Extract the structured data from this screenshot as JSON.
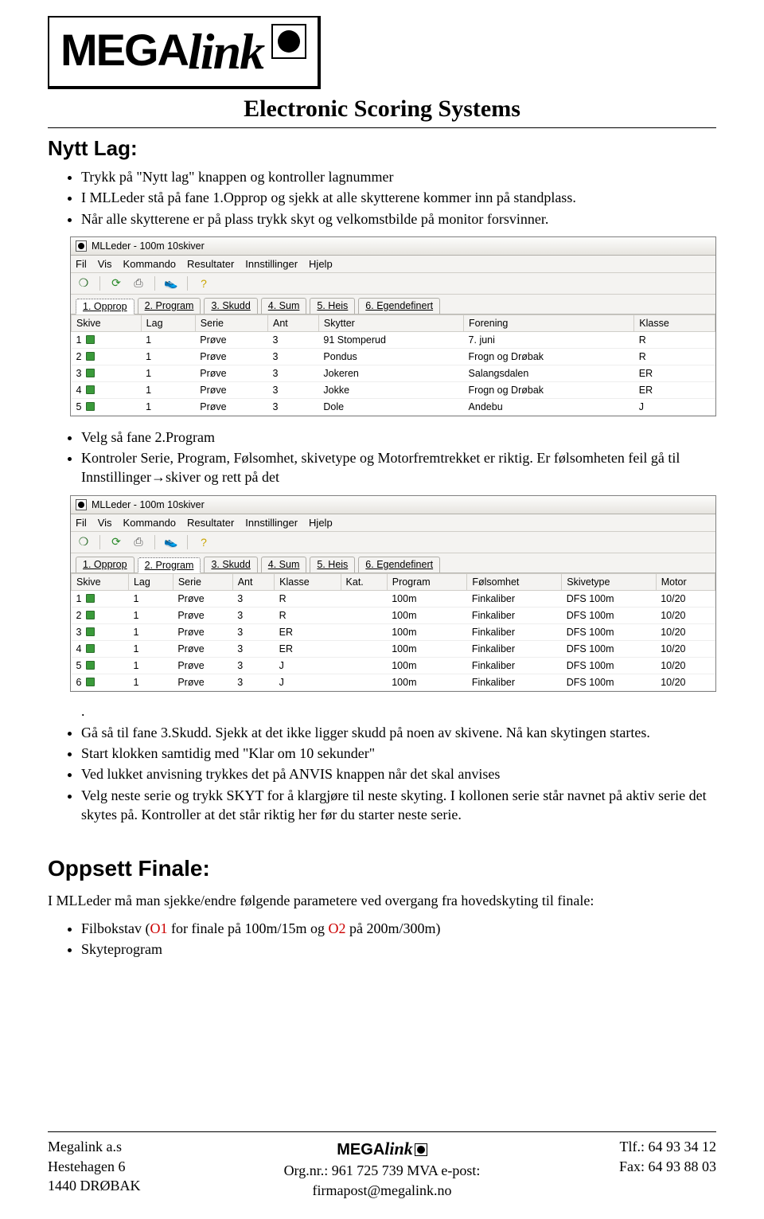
{
  "header": {
    "logo_mega": "MEGA",
    "logo_link": "link",
    "title": "Electronic Scoring Systems"
  },
  "section1": {
    "heading": "Nytt Lag:",
    "bullets_a": [
      "Trykk på \"Nytt lag\" knappen og kontroller lagnummer",
      "I MLLeder stå på fane 1.Opprop og sjekk at alle skytterene kommer inn på standplass.",
      "Når alle skytterene er på plass trykk skyt og velkomstbilde på monitor forsvinner."
    ],
    "bullets_b": [
      "Velg så fane 2.Program",
      "Kontroler Serie, Program, Følsomhet, skivetype og Motorfremtrekket er riktig. Er følsomheten feil gå til Innstillinger→skiver og rett på det"
    ],
    "bullets_c": [
      "Gå så til fane 3.Skudd. Sjekk at det ikke ligger skudd på noen av skivene. Nå kan skytingen startes.",
      "Start klokken samtidig med \"Klar om 10 sekunder\"",
      "Ved lukket anvisning trykkes det på ANVIS knappen når det skal anvises",
      "Velg neste serie og trykk SKYT for å klargjøre til neste skyting. I kollonen serie står navnet på aktiv serie det skytes på. Kontroller at det står riktig her før du starter neste serie."
    ],
    "dot": "."
  },
  "app1": {
    "title": "MLLeder - 100m 10skiver",
    "menus": [
      "Fil",
      "Vis",
      "Kommando",
      "Resultater",
      "Innstillinger",
      "Hjelp"
    ],
    "tabs": [
      "1. Opprop",
      "2. Program",
      "3. Skudd",
      "4. Sum",
      "5. Heis",
      "6. Egendefinert"
    ],
    "active_tab": 0,
    "columns": [
      "Skive",
      "Lag",
      "Serie",
      "Ant",
      "Skytter",
      "Forening",
      "Klasse"
    ],
    "rows": [
      {
        "skive": "1",
        "lag": "1",
        "serie": "Prøve",
        "ant": "3",
        "skytter": "91 Stomperud",
        "forening": "7. juni",
        "klasse": "R"
      },
      {
        "skive": "2",
        "lag": "1",
        "serie": "Prøve",
        "ant": "3",
        "skytter": "Pondus",
        "forening": "Frogn og Drøbak",
        "klasse": "R"
      },
      {
        "skive": "3",
        "lag": "1",
        "serie": "Prøve",
        "ant": "3",
        "skytter": "Jokeren",
        "forening": "Salangsdalen",
        "klasse": "ER"
      },
      {
        "skive": "4",
        "lag": "1",
        "serie": "Prøve",
        "ant": "3",
        "skytter": "Jokke",
        "forening": "Frogn og Drøbak",
        "klasse": "ER"
      },
      {
        "skive": "5",
        "lag": "1",
        "serie": "Prøve",
        "ant": "3",
        "skytter": "Dole",
        "forening": "Andebu",
        "klasse": "J"
      }
    ]
  },
  "app2": {
    "title": "MLLeder - 100m 10skiver",
    "menus": [
      "Fil",
      "Vis",
      "Kommando",
      "Resultater",
      "Innstillinger",
      "Hjelp"
    ],
    "tabs": [
      "1. Opprop",
      "2. Program",
      "3. Skudd",
      "4. Sum",
      "5. Heis",
      "6. Egendefinert"
    ],
    "active_tab": 1,
    "columns": [
      "Skive",
      "Lag",
      "Serie",
      "Ant",
      "Klasse",
      "Kat.",
      "Program",
      "Følsomhet",
      "Skivetype",
      "Motor"
    ],
    "rows": [
      {
        "skive": "1",
        "lag": "1",
        "serie": "Prøve",
        "ant": "3",
        "klasse": "R",
        "kat": "",
        "program": "100m",
        "folsomhet": "Finkaliber",
        "skivetype": "DFS 100m",
        "motor": "10/20"
      },
      {
        "skive": "2",
        "lag": "1",
        "serie": "Prøve",
        "ant": "3",
        "klasse": "R",
        "kat": "",
        "program": "100m",
        "folsomhet": "Finkaliber",
        "skivetype": "DFS 100m",
        "motor": "10/20"
      },
      {
        "skive": "3",
        "lag": "1",
        "serie": "Prøve",
        "ant": "3",
        "klasse": "ER",
        "kat": "",
        "program": "100m",
        "folsomhet": "Finkaliber",
        "skivetype": "DFS 100m",
        "motor": "10/20"
      },
      {
        "skive": "4",
        "lag": "1",
        "serie": "Prøve",
        "ant": "3",
        "klasse": "ER",
        "kat": "",
        "program": "100m",
        "folsomhet": "Finkaliber",
        "skivetype": "DFS 100m",
        "motor": "10/20"
      },
      {
        "skive": "5",
        "lag": "1",
        "serie": "Prøve",
        "ant": "3",
        "klasse": "J",
        "kat": "",
        "program": "100m",
        "folsomhet": "Finkaliber",
        "skivetype": "DFS 100m",
        "motor": "10/20"
      },
      {
        "skive": "6",
        "lag": "1",
        "serie": "Prøve",
        "ant": "3",
        "klasse": "J",
        "kat": "",
        "program": "100m",
        "folsomhet": "Finkaliber",
        "skivetype": "DFS 100m",
        "motor": "10/20"
      }
    ]
  },
  "section2": {
    "heading": "Oppsett Finale:",
    "intro": "I MLLeder må man sjekke/endre følgende parametere ved overgang fra hovedskyting til finale:",
    "bullets": [
      {
        "pre": "Filbokstav (",
        "red1": "O1",
        "mid": " for finale på 100m/15m og ",
        "red2": "O2",
        "post": " på 200m/300m)"
      },
      {
        "plain": "Skyteprogram"
      }
    ]
  },
  "footer": {
    "left": [
      "Megalink a.s",
      "Hestehagen 6",
      "1440 DRØBAK"
    ],
    "center_logo_mega": "MEGA",
    "center_logo_link": "link",
    "center_line": "Org.nr.: 961 725 739 MVA e-post: firmapost@megalink.no",
    "right": [
      "Tlf.: 64 93 34 12",
      "Fax: 64 93 88 03",
      ""
    ]
  }
}
